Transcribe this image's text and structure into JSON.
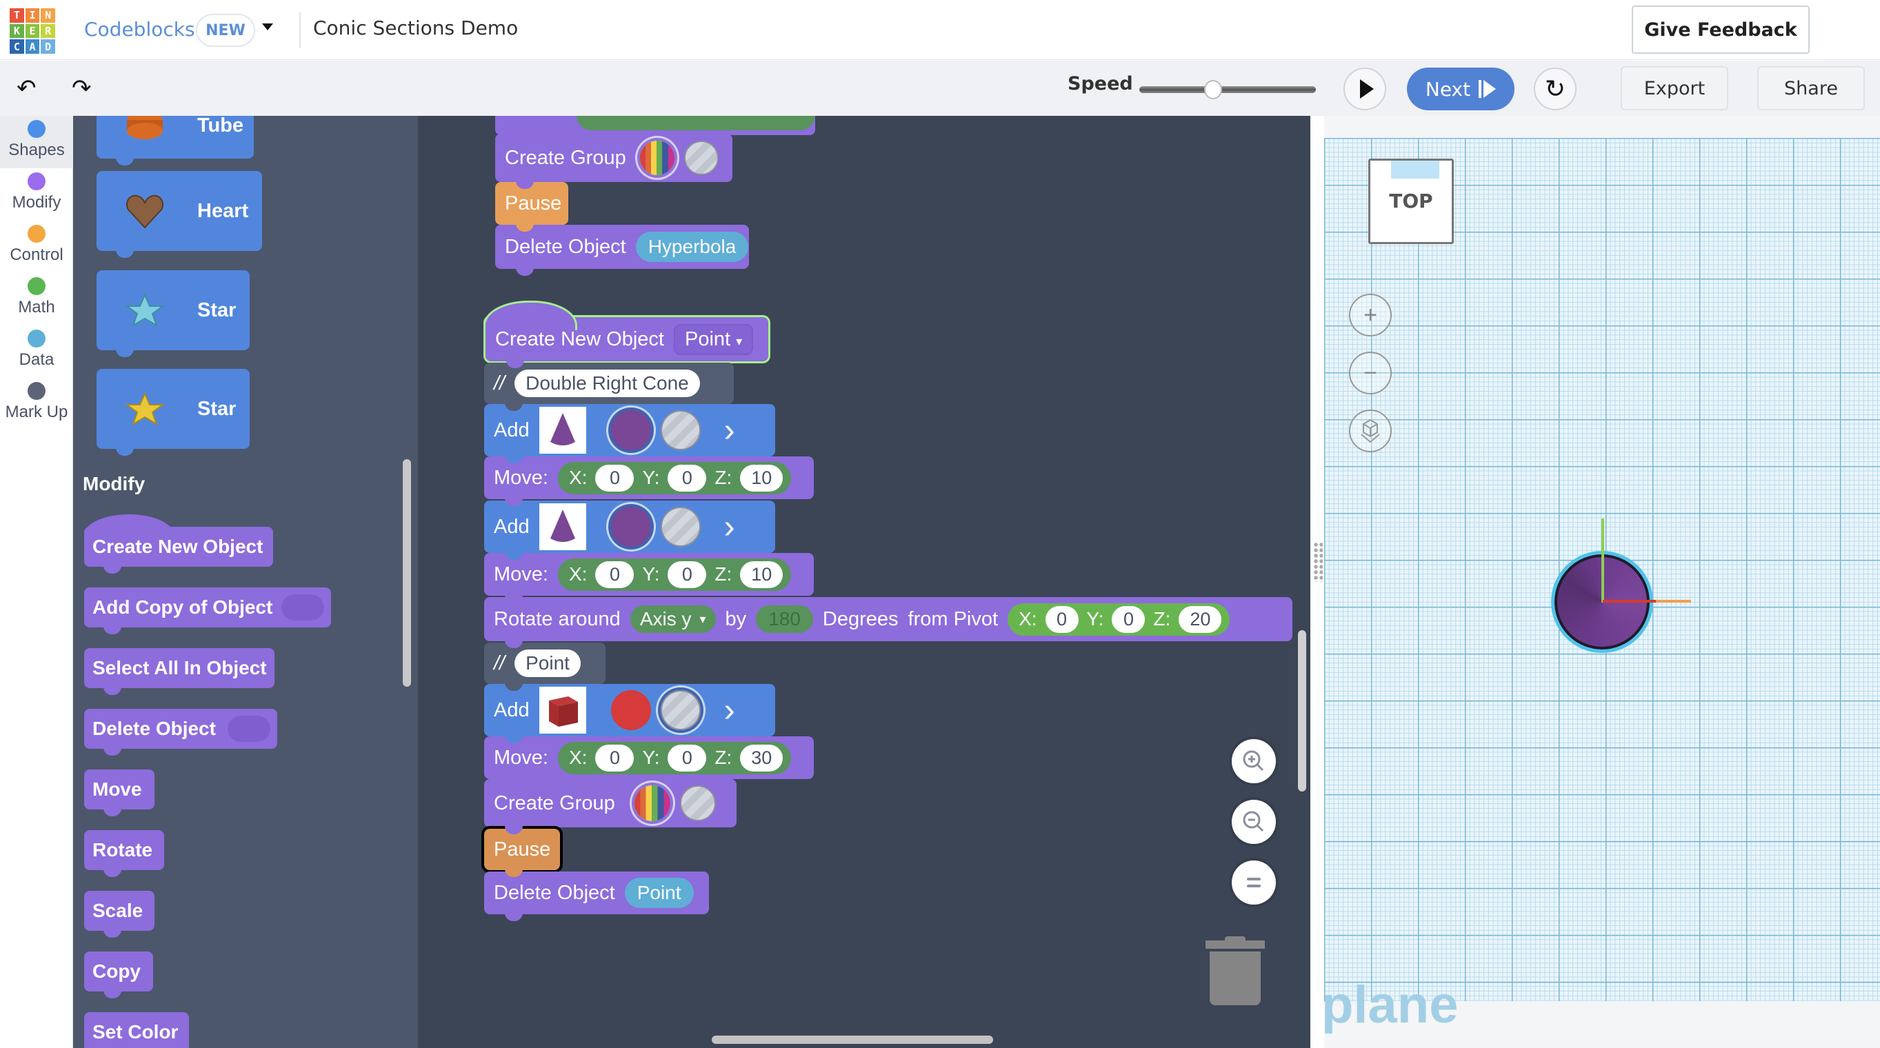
{
  "header": {
    "logo_letters": [
      "T",
      "I",
      "N",
      "K",
      "E",
      "R",
      "C",
      "A",
      "D"
    ],
    "logo_colors": [
      "#e8533a",
      "#f08a3c",
      "#f4a347",
      "#6ab04a",
      "#8cc23f",
      "#c5d43c",
      "#2b67b1",
      "#3f8ccb",
      "#6fb0e0"
    ],
    "app_name": "Codeblocks",
    "badge": "NEW",
    "project_title": "Conic Sections Demo",
    "feedback_label": "Give Feedback"
  },
  "toolbar": {
    "undo_icon": "↶",
    "redo_icon": "↷",
    "speed_label": "Speed",
    "speed_value": 0.5,
    "next_label": "Next",
    "reset_icon": "↻",
    "export_label": "Export",
    "share_label": "Share"
  },
  "categories": [
    {
      "label": "Shapes",
      "color": "#4a90e8",
      "active": true
    },
    {
      "label": "Modify",
      "color": "#9b6cec"
    },
    {
      "label": "Control",
      "color": "#f4a640"
    },
    {
      "label": "Math",
      "color": "#5ab552"
    },
    {
      "label": "Data",
      "color": "#5fb0d8"
    },
    {
      "label": "Mark Up",
      "color": "#5c6577"
    }
  ],
  "flyout": {
    "shape_blocks": [
      {
        "name": "Tube",
        "icon": "tube-icon"
      },
      {
        "name": "Heart",
        "icon": "heart-icon"
      },
      {
        "name": "Star",
        "icon": "star-icon",
        "color": "#7fcfe0"
      },
      {
        "name": "Star",
        "icon": "star-icon",
        "color": "#e8c83a"
      }
    ],
    "section_title": "Modify",
    "modify_blocks": [
      "Create New Object",
      "Add Copy of Object",
      "Select All In Object",
      "Delete Object",
      "Move",
      "Rotate",
      "Scale",
      "Copy",
      "Set Color"
    ]
  },
  "canvas": {
    "create_group_1": "Create Group",
    "pause_1": "Pause",
    "delete_object_1": {
      "label": "Delete Object",
      "value": "Hyperbola"
    },
    "create_new_object": {
      "label": "Create New Object",
      "value": "Point"
    },
    "comment_1": {
      "prefix": "//",
      "text": "Double Right Cone"
    },
    "add_1": {
      "label": "Add",
      "shape": "cone"
    },
    "move_1": {
      "label": "Move:",
      "x": "0",
      "y": "0",
      "z": "10"
    },
    "add_2": {
      "label": "Add",
      "shape": "cone"
    },
    "move_2": {
      "label": "Move:",
      "x": "0",
      "y": "0",
      "z": "10"
    },
    "rotate": {
      "label": "Rotate around",
      "axis": "Axis y",
      "by": "by",
      "degrees": "180",
      "degrees_label": "Degrees",
      "pivot_label": "from Pivot",
      "x": "0",
      "y": "0",
      "z": "20"
    },
    "comment_2": {
      "prefix": "//",
      "text": "Point"
    },
    "add_3": {
      "label": "Add",
      "shape": "box"
    },
    "move_3": {
      "label": "Move:",
      "x": "0",
      "y": "0",
      "z": "30"
    },
    "create_group_2": "Create Group",
    "pause_2": "Pause",
    "delete_object_2": {
      "label": "Delete Object",
      "value": "Point"
    },
    "axis_labels": {
      "x": "X:",
      "y": "Y:",
      "z": "Z:"
    }
  },
  "viewport": {
    "viewcube_label": "TOP",
    "plane_label": "plane",
    "zoom_in": "+",
    "zoom_out": "−"
  }
}
